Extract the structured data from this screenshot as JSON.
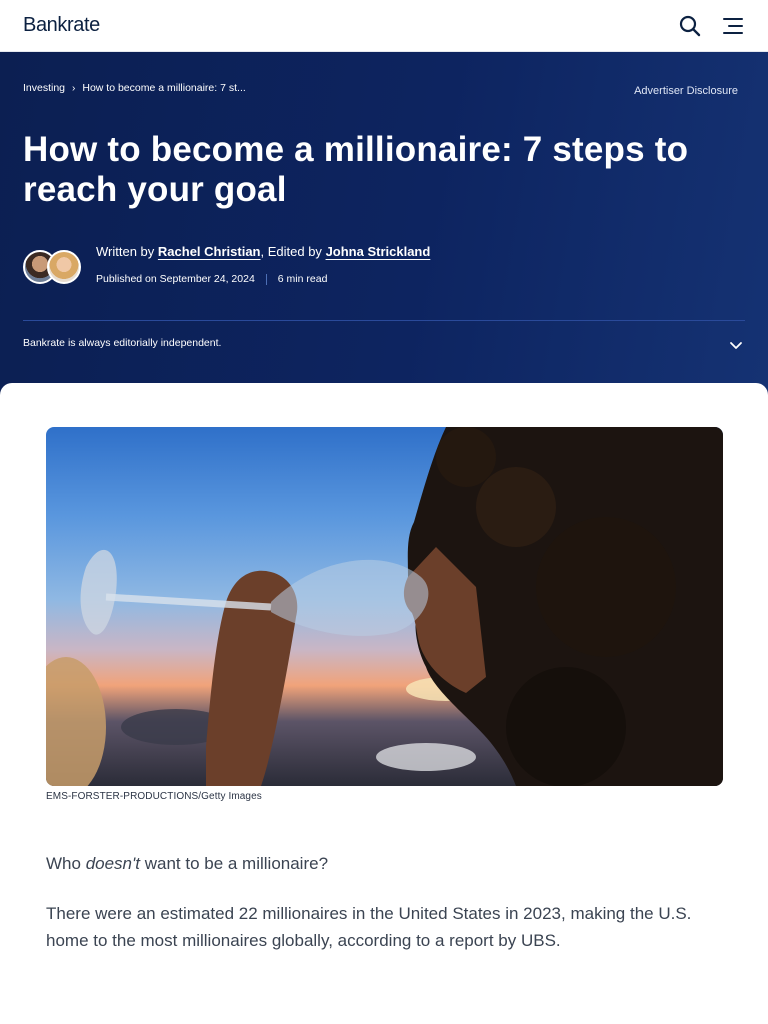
{
  "header": {
    "logo_text": "Bankrate",
    "icons": [
      "search-icon",
      "hamburger-menu-icon"
    ]
  },
  "hero": {
    "breadcrumb": [
      "Investing",
      "How to become a millionaire: 7 st..."
    ],
    "advertiser_disclosure": "Advertiser Disclosure",
    "title": "How to become a millionaire: 7 steps to reach your goal",
    "byline": {
      "written_by_prefix": "Written by",
      "author": "Rachel Christian",
      "edited_by_prefix": ", Edited by",
      "editor": "Johna Strickland"
    },
    "published": "Published on September 24, 2024",
    "read_time": "6 min read",
    "editorial_note": "Bankrate is always editorially independent."
  },
  "article": {
    "image_caption": "EMS-FORSTER-PRODUCTIONS/Getty Images",
    "p1_before": "Who ",
    "p1_em": "doesn't",
    "p1_after": " want to be a millionaire?",
    "p2": "There were an estimated 22 millionaires in the United States in 2023, making the U.S. home to the most millionaires globally, according to a report by UBS."
  },
  "colors": {
    "hero_bg": "#0d2460",
    "brand_text": "#0c2141",
    "body_text": "#3b4452"
  }
}
